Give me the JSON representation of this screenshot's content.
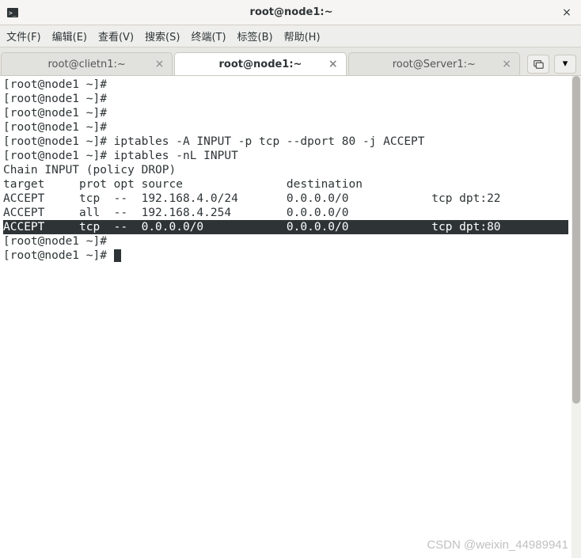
{
  "titlebar": {
    "title": "root@node1:~",
    "close_label": "×"
  },
  "menubar": {
    "file": "文件(F)",
    "edit": "编辑(E)",
    "view": "查看(V)",
    "search": "搜索(S)",
    "terminal": "终端(T)",
    "tabs": "标签(B)",
    "help": "帮助(H)"
  },
  "tabs": [
    {
      "label": "root@clietn1:~",
      "active": false
    },
    {
      "label": "root@node1:~",
      "active": true
    },
    {
      "label": "root@Server1:~",
      "active": false
    }
  ],
  "terminal": {
    "prompt": "[root@node1 ~]# ",
    "lines": [
      {
        "t": "[root@node1 ~]# "
      },
      {
        "t": "[root@node1 ~]# "
      },
      {
        "t": "[root@node1 ~]# "
      },
      {
        "t": "[root@node1 ~]# "
      },
      {
        "t": "[root@node1 ~]# iptables -A INPUT -p tcp --dport 80 -j ACCEPT"
      },
      {
        "t": "[root@node1 ~]# iptables -nL INPUT"
      },
      {
        "t": "Chain INPUT (policy DROP)"
      },
      {
        "t": "target     prot opt source               destination         "
      },
      {
        "t": "ACCEPT     tcp  --  192.168.4.0/24       0.0.0.0/0            tcp dpt:22"
      },
      {
        "t": "ACCEPT     all  --  192.168.4.254        0.0.0.0/0           "
      },
      {
        "t": "ACCEPT     tcp  --  0.0.0.0/0            0.0.0.0/0            tcp dpt:80",
        "hl": true
      },
      {
        "t": "[root@node1 ~]# "
      },
      {
        "t": "[root@node1 ~]# ",
        "cursor": true
      }
    ]
  },
  "watermark": "CSDN @weixin_44989941"
}
